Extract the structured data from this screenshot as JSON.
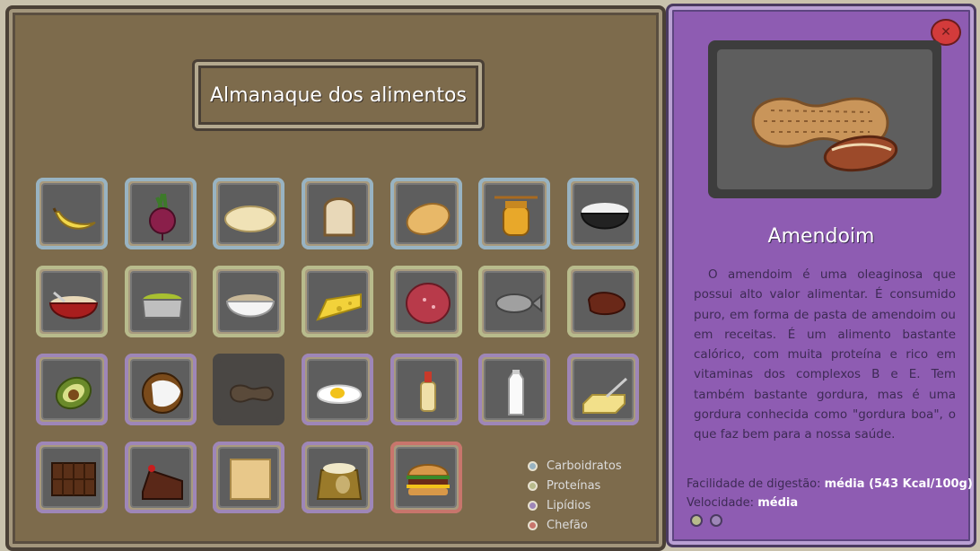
{
  "title": "Almanaque dos alimentos",
  "legend": [
    {
      "label": "Carboidratos",
      "color": "#98b3c2"
    },
    {
      "label": "Proteínas",
      "color": "#b8bb8c"
    },
    {
      "label": "Lipídios",
      "color": "#9e86b8"
    },
    {
      "label": "Chefão",
      "color": "#c8756c"
    }
  ],
  "tiles": [
    {
      "icon": "banana-icon",
      "cat": "carb"
    },
    {
      "icon": "beet-icon",
      "cat": "carb"
    },
    {
      "icon": "tapioca-icon",
      "cat": "carb"
    },
    {
      "icon": "bread-slice-icon",
      "cat": "carb"
    },
    {
      "icon": "bread-roll-icon",
      "cat": "carb"
    },
    {
      "icon": "honey-jar-icon",
      "cat": "carb"
    },
    {
      "icon": "rice-bowl-icon",
      "cat": "carb"
    },
    {
      "icon": "oatmeal-bowl-icon",
      "cat": "prot"
    },
    {
      "icon": "peas-pot-icon",
      "cat": "prot"
    },
    {
      "icon": "beans-bowl-icon",
      "cat": "prot"
    },
    {
      "icon": "cheese-icon",
      "cat": "prot"
    },
    {
      "icon": "salami-icon",
      "cat": "prot"
    },
    {
      "icon": "fish-icon",
      "cat": "prot"
    },
    {
      "icon": "steak-icon",
      "cat": "prot"
    },
    {
      "icon": "avocado-icon",
      "cat": "lip"
    },
    {
      "icon": "coconut-icon",
      "cat": "lip"
    },
    {
      "icon": "peanut-icon",
      "cat": "sel"
    },
    {
      "icon": "fried-egg-icon",
      "cat": "lip"
    },
    {
      "icon": "oil-bottle-icon",
      "cat": "lip"
    },
    {
      "icon": "milk-bottle-icon",
      "cat": "lip"
    },
    {
      "icon": "butter-icon",
      "cat": "lip"
    },
    {
      "icon": "chocolate-bar-icon",
      "cat": "lip"
    },
    {
      "icon": "cake-slice-icon",
      "cat": "lip"
    },
    {
      "icon": "cracker-icon",
      "cat": "lip"
    },
    {
      "icon": "chips-bag-icon",
      "cat": "lip"
    },
    {
      "icon": "burger-icon",
      "cat": "boss"
    }
  ],
  "detail": {
    "name": "Amendoim",
    "description": "O amendoim é uma oleaginosa que possui alto valor alimentar. É consumido puro, em forma de pasta de amendoim ou em receitas. É um alimento bastante calórico, com muita proteína e rico em vitaminas dos complexos B e E. Tem também bastante gordura, mas é uma gordura conhecida como \"gordura boa\", o que faz bem para a nossa saúde.",
    "digestion_label": "Facilidade de digestão:",
    "digestion_value": "média (543 Kcal/100g)",
    "speed_label": "Velocidade:",
    "speed_value": "média",
    "image_icon": "peanut-icon",
    "dots": [
      "#b8bb8c",
      "#9e86b8"
    ]
  },
  "close_icon": "close-icon"
}
